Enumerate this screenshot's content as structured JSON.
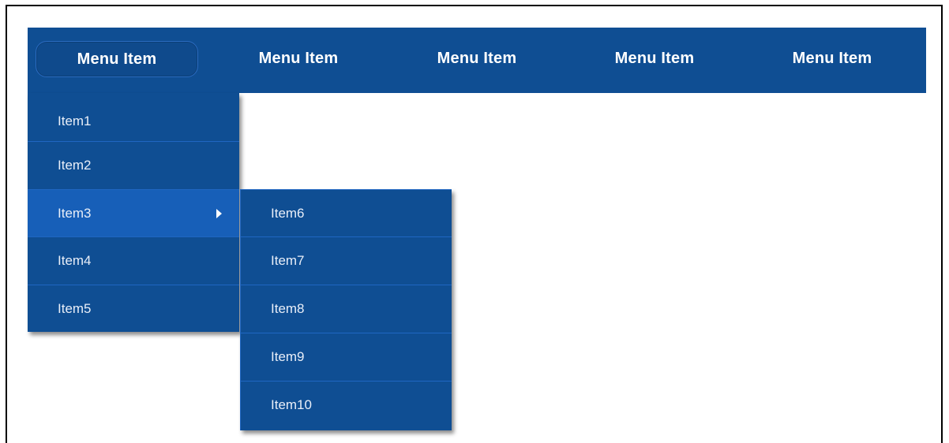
{
  "menubar": {
    "items": [
      {
        "label": "Menu Item"
      },
      {
        "label": "Menu Item"
      },
      {
        "label": "Menu Item"
      },
      {
        "label": "Menu Item"
      },
      {
        "label": "Menu Item"
      }
    ]
  },
  "dropdown": {
    "items": [
      {
        "label": "Item1"
      },
      {
        "label": "Item2"
      },
      {
        "label": "Item3",
        "submenu_icon": "chevron-right-icon"
      },
      {
        "label": "Item4"
      },
      {
        "label": "Item5"
      }
    ]
  },
  "submenu": {
    "items": [
      {
        "label": "Item6"
      },
      {
        "label": "Item7"
      },
      {
        "label": "Item8"
      },
      {
        "label": "Item9"
      },
      {
        "label": "Item10"
      }
    ]
  },
  "colors": {
    "menu_background": "#0f4e93",
    "highlight": "#175fb8",
    "separator": "#1f66c2",
    "text": "#ffffff"
  }
}
